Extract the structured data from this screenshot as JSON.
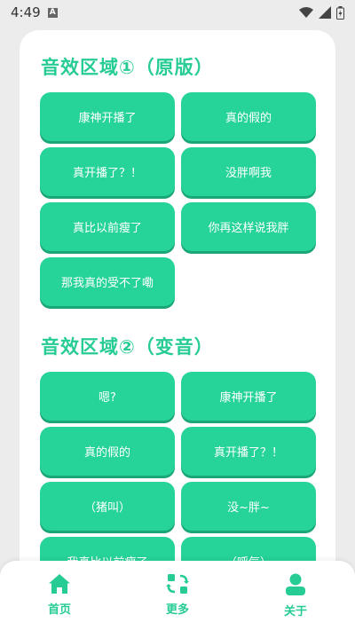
{
  "status": {
    "time": "4:49",
    "notification_letter": "A"
  },
  "sections": [
    {
      "title": "音效区域①（原版）",
      "buttons": [
        "康神开播了",
        "真的假的",
        "真开播了？！",
        "没胖啊我",
        "真比以前瘦了",
        "你再这样说我胖",
        "那我真的受不了嘞"
      ]
    },
    {
      "title": "音效区域②（变音）",
      "buttons": [
        "嗯?",
        "康神开播了",
        "真的假的",
        "真开播了？！",
        "（猪叫）",
        "没~胖~",
        "我真比以前瘦了",
        "（呼气）"
      ]
    }
  ],
  "nav": [
    {
      "label": "首页",
      "icon": "home-icon"
    },
    {
      "label": "更多",
      "icon": "more-icon"
    },
    {
      "label": "关于",
      "icon": "user-icon"
    }
  ],
  "colors": {
    "accent": "#26cc94",
    "button": "#26d399",
    "button_shadow": "#1aa676"
  }
}
